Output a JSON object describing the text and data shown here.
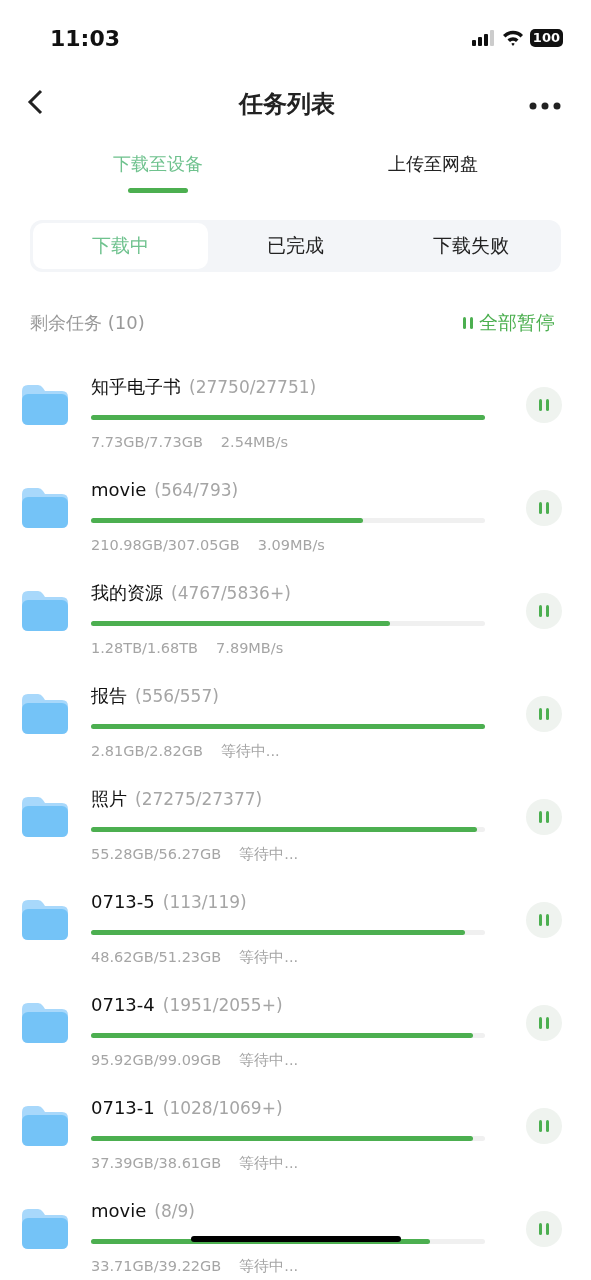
{
  "status_bar": {
    "time": "11:03",
    "battery": "100"
  },
  "nav": {
    "title": "任务列表"
  },
  "tabs": [
    {
      "label": "下载至设备",
      "selected": true
    },
    {
      "label": "上传至网盘",
      "selected": false
    }
  ],
  "segments": [
    {
      "label": "下载中",
      "selected": true
    },
    {
      "label": "已完成",
      "selected": false
    },
    {
      "label": "下载失败",
      "selected": false
    }
  ],
  "summary": {
    "label": "剩余任务 (10)",
    "action": "全部暂停"
  },
  "tasks": [
    {
      "name": "知乎电子书",
      "count": "(27750/27751)",
      "level": 1.0,
      "size": "7.73GB/7.73GB",
      "status": "2.54MB/s"
    },
    {
      "name": "movie",
      "count": "(564/793)",
      "level": 0.69,
      "size": "210.98GB/307.05GB",
      "status": "3.09MB/s"
    },
    {
      "name": "我的资源",
      "count": "(4767/5836+)",
      "level": 0.76,
      "size": "1.28TB/1.68TB",
      "status": "7.89MB/s"
    },
    {
      "name": "报告",
      "count": "(556/557)",
      "level": 1.0,
      "size": "2.81GB/2.82GB",
      "status": "等待中..."
    },
    {
      "name": "照片",
      "count": "(27275/27377)",
      "level": 0.98,
      "size": "55.28GB/56.27GB",
      "status": "等待中..."
    },
    {
      "name": "0713-5",
      "count": "(113/119)",
      "level": 0.95,
      "size": "48.62GB/51.23GB",
      "status": "等待中..."
    },
    {
      "name": "0713-4",
      "count": "(1951/2055+)",
      "level": 0.97,
      "size": "95.92GB/99.09GB",
      "status": "等待中..."
    },
    {
      "name": "0713-1",
      "count": "(1028/1069+)",
      "level": 0.97,
      "size": "37.39GB/38.61GB",
      "status": "等待中..."
    },
    {
      "name": "movie",
      "count": "(8/9)",
      "level": 0.86,
      "size": "33.71GB/39.22GB",
      "status": "等待中..."
    }
  ]
}
